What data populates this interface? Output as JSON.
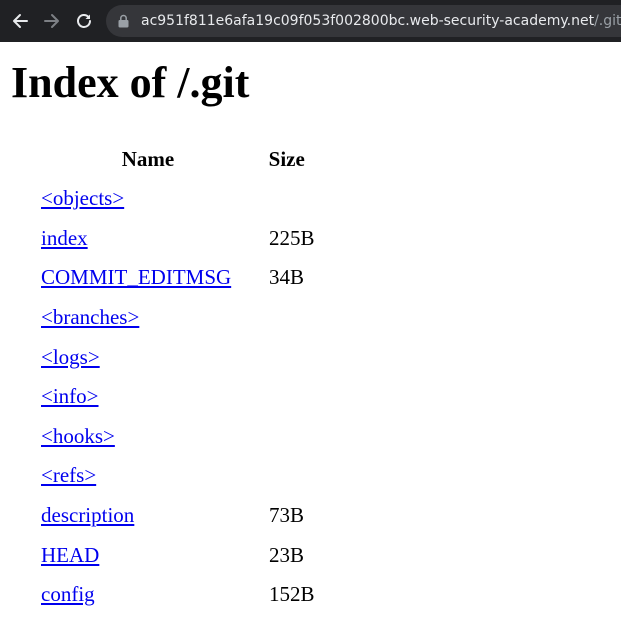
{
  "browser": {
    "url_host": "ac951f811e6afa19c09f053f002800bc.web-security-academy.net",
    "url_path": "/.git"
  },
  "page": {
    "title": "Index of /.git",
    "columns": {
      "name": "Name",
      "size": "Size"
    },
    "rows": [
      {
        "name": "<objects>",
        "size": ""
      },
      {
        "name": "index",
        "size": "225B"
      },
      {
        "name": "COMMIT_EDITMSG",
        "size": "34B"
      },
      {
        "name": "<branches>",
        "size": ""
      },
      {
        "name": "<logs>",
        "size": ""
      },
      {
        "name": "<info>",
        "size": ""
      },
      {
        "name": "<hooks>",
        "size": ""
      },
      {
        "name": "<refs>",
        "size": ""
      },
      {
        "name": "description",
        "size": "73B"
      },
      {
        "name": "HEAD",
        "size": "23B"
      },
      {
        "name": "config",
        "size": "152B"
      }
    ]
  },
  "colors": {
    "toolbar_bg": "#202124",
    "omnibox_bg": "#35363a",
    "link": "#0000ee"
  }
}
